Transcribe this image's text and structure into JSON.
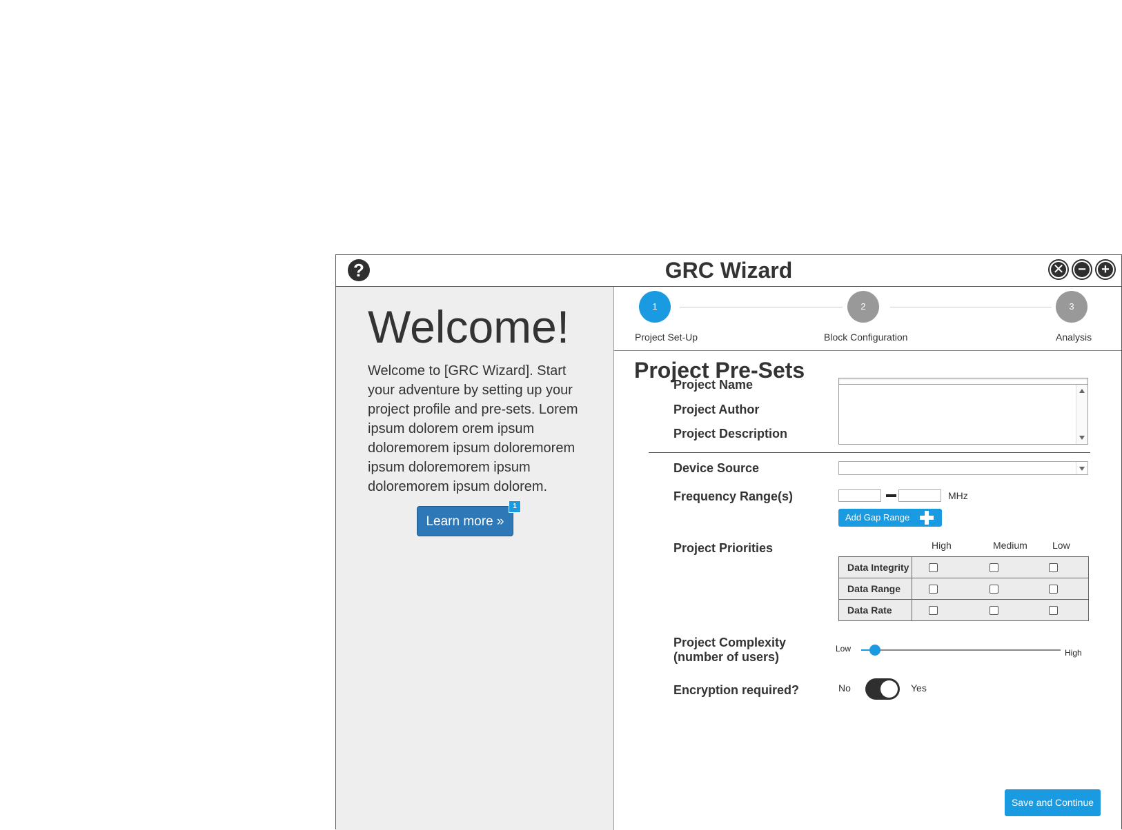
{
  "window": {
    "title": "GRC Wizard",
    "help_icon": "question-circle-icon",
    "controls": [
      "close-icon",
      "minimize-icon",
      "maximize-icon"
    ]
  },
  "welcome": {
    "heading": "Welcome!",
    "body": "Welcome to [GRC Wizard]. Start your adventure by setting up your project profile and pre-sets. Lorem ipsum dolorem orem ipsum doloremorem ipsum doloremorem ipsum doloremorem ipsum doloremorem ipsum dolorem.",
    "learn_more_label": "Learn more »",
    "badge": "1"
  },
  "steps": [
    {
      "number": "1",
      "label": "Project Set-Up",
      "active": true
    },
    {
      "number": "2",
      "label": "Block Configuration",
      "active": false
    },
    {
      "number": "3",
      "label": "Analysis",
      "active": false
    }
  ],
  "form": {
    "section_title": "Project Pre-Sets",
    "project_name_label": "Project Name",
    "project_name_value": "",
    "project_author_label": "Project Author",
    "project_author_value": "",
    "project_description_label": "Project Description",
    "project_description_value": "",
    "device_source_label": "Device Source",
    "device_source_value": "",
    "frequency_label": "Frequency Range(s)",
    "frequency_from": "",
    "frequency_to": "",
    "frequency_unit": "MHz",
    "add_gap_label": "Add Gap Range",
    "priorities_label": "Project Priorities",
    "priority_columns": [
      "High",
      "Medium",
      "Low"
    ],
    "priority_rows": [
      "Data Integrity",
      "Data Range",
      "Data Rate"
    ],
    "complexity_label_line1": "Project Complexity",
    "complexity_label_line2": "(number of users)",
    "complexity_low": "Low",
    "complexity_high": "High",
    "complexity_value_fraction": 0.07,
    "encryption_label": "Encryption required?",
    "encryption_no": "No",
    "encryption_yes": "Yes",
    "encryption_on": true,
    "save_label": "Save and Continue"
  },
  "colors": {
    "accent": "#1a9ae0",
    "step_inactive": "#999999",
    "learn_more": "#2f78b7",
    "left_panel": "#eeeeee"
  }
}
